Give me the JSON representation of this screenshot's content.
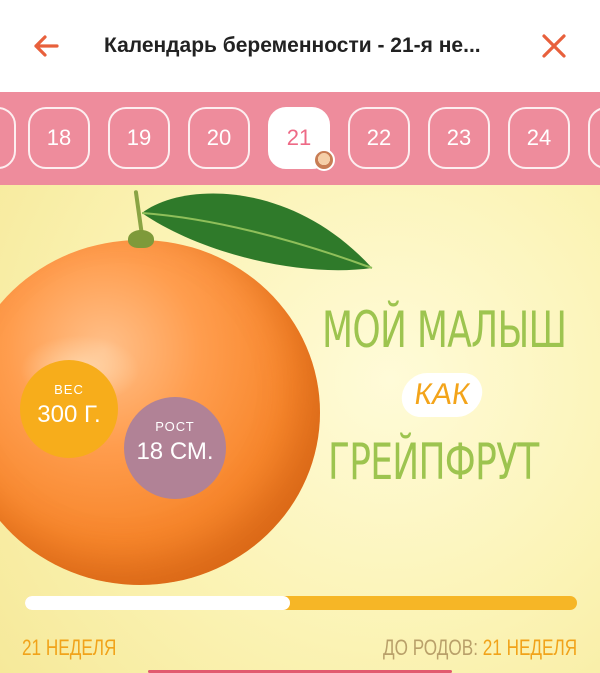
{
  "header": {
    "title": "Календарь беременности - 21-я не...",
    "back_icon": "arrow-left-icon",
    "close_icon": "close-icon",
    "accent_color": "#E8603C"
  },
  "week_strip": {
    "background": "#EE8C9C",
    "weeks": [
      "18",
      "19",
      "20",
      "21",
      "22",
      "23",
      "24"
    ],
    "active_week": "21"
  },
  "banner": {
    "headline_line1": "МОЙ МАЛЫШ",
    "headline_like": "КАК",
    "headline_line2": "ГРЕЙПФРУТ",
    "weight": {
      "label": "ВЕС",
      "value": "300 Г."
    },
    "height": {
      "label": "РОСТ",
      "value": "18 СМ."
    },
    "progress": {
      "fraction": 0.48
    },
    "current_week": "21 НЕДЕЛЯ",
    "until_birth_label": "ДО РОДОВ:",
    "until_birth_value": "21 НЕДЕЛЯ"
  }
}
